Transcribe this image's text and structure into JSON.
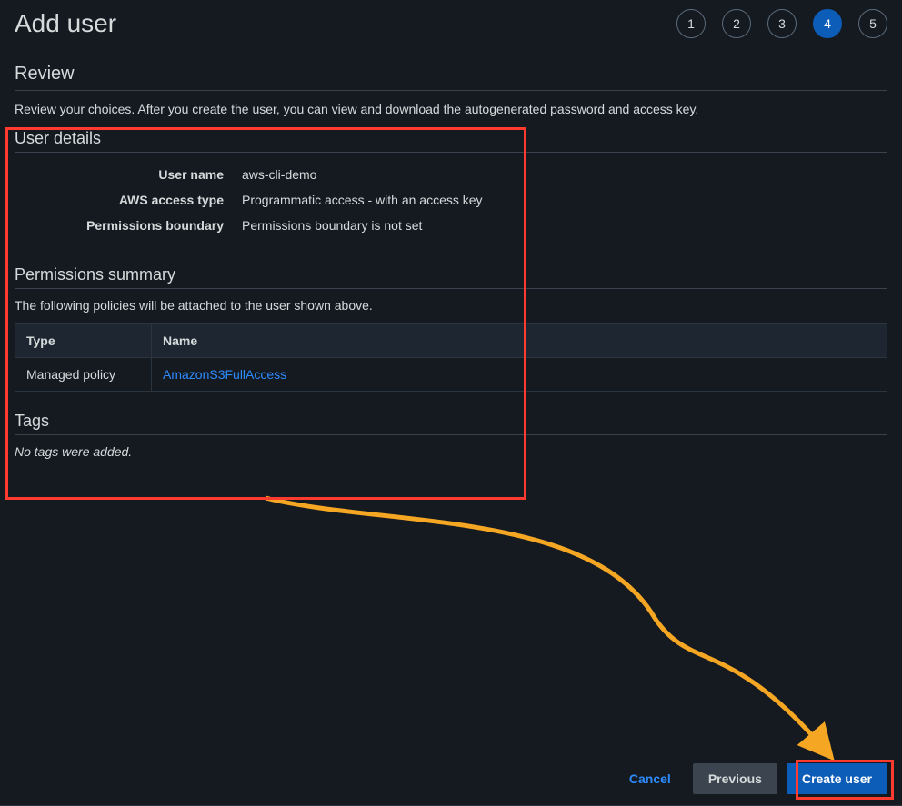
{
  "header": {
    "title": "Add user",
    "steps": [
      "1",
      "2",
      "3",
      "4",
      "5"
    ],
    "active_step_index": 3
  },
  "review": {
    "title": "Review",
    "description": "Review your choices. After you create the user, you can view and download the autogenerated password and access key."
  },
  "user_details": {
    "title": "User details",
    "rows": [
      {
        "label": "User name",
        "value": "aws-cli-demo"
      },
      {
        "label": "AWS access type",
        "value": "Programmatic access - with an access key"
      },
      {
        "label": "Permissions boundary",
        "value": "Permissions boundary is not set"
      }
    ]
  },
  "permissions_summary": {
    "title": "Permissions summary",
    "description": "The following policies will be attached to the user shown above.",
    "columns": {
      "type": "Type",
      "name": "Name"
    },
    "rows": [
      {
        "type": "Managed policy",
        "name": "AmazonS3FullAccess"
      }
    ]
  },
  "tags": {
    "title": "Tags",
    "empty_text": "No tags were added."
  },
  "footer": {
    "cancel": "Cancel",
    "previous": "Previous",
    "create": "Create user"
  },
  "annotations": {
    "highlight_color": "#ff3b30",
    "arrow_color": "#f5a623"
  }
}
